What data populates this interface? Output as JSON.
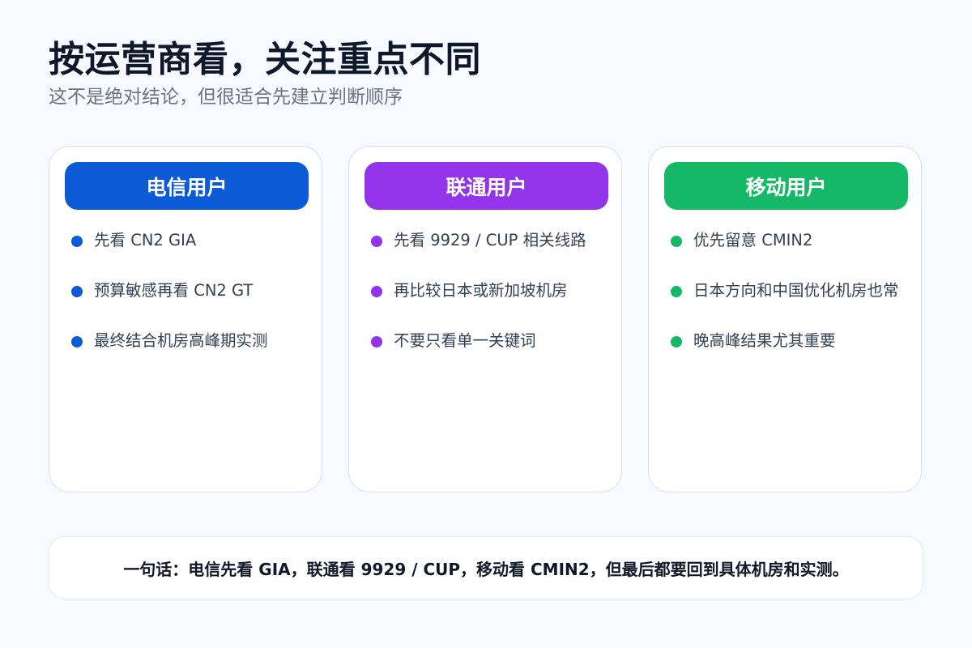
{
  "header": {
    "title": "按运营商看，关注重点不同",
    "subtitle": "这不是绝对结论，但很适合先建立判断顺序"
  },
  "cards": [
    {
      "title": "电信用户",
      "color": "#0b5bd7",
      "items": [
        "先看 CN2 GIA",
        "预算敏感再看 CN2 GT",
        "最终结合机房高峰期实测"
      ]
    },
    {
      "title": "联通用户",
      "color": "#9333ea",
      "items": [
        "先看 9929 / CUP 相关线路",
        "再比较日本或新加坡机房",
        "不要只看单一关键词"
      ]
    },
    {
      "title": "移动用户",
      "color": "#14b866",
      "items": [
        "优先留意 CMIN2",
        "日本方向和中国优化机房也常",
        "晚高峰结果尤其重要"
      ]
    }
  ],
  "summary": {
    "text": "一句话：电信先看 GIA，联通看 9929 / CUP，移动看 CMIN2，但最后都要回到具体机房和实测。"
  }
}
